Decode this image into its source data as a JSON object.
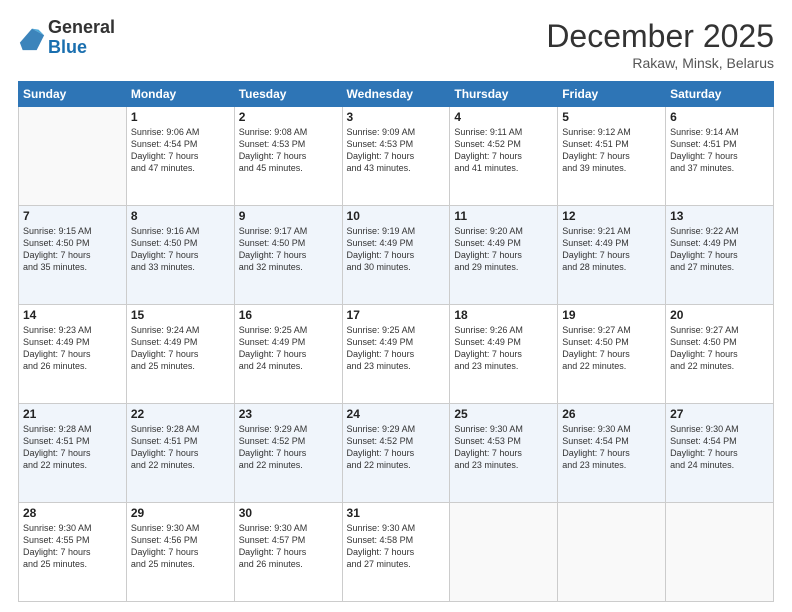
{
  "header": {
    "logo_general": "General",
    "logo_blue": "Blue",
    "title": "December 2025",
    "location": "Rakaw, Minsk, Belarus"
  },
  "days_of_week": [
    "Sunday",
    "Monday",
    "Tuesday",
    "Wednesday",
    "Thursday",
    "Friday",
    "Saturday"
  ],
  "weeks": [
    {
      "days": [
        {
          "num": "",
          "info": ""
        },
        {
          "num": "1",
          "info": "Sunrise: 9:06 AM\nSunset: 4:54 PM\nDaylight: 7 hours\nand 47 minutes."
        },
        {
          "num": "2",
          "info": "Sunrise: 9:08 AM\nSunset: 4:53 PM\nDaylight: 7 hours\nand 45 minutes."
        },
        {
          "num": "3",
          "info": "Sunrise: 9:09 AM\nSunset: 4:53 PM\nDaylight: 7 hours\nand 43 minutes."
        },
        {
          "num": "4",
          "info": "Sunrise: 9:11 AM\nSunset: 4:52 PM\nDaylight: 7 hours\nand 41 minutes."
        },
        {
          "num": "5",
          "info": "Sunrise: 9:12 AM\nSunset: 4:51 PM\nDaylight: 7 hours\nand 39 minutes."
        },
        {
          "num": "6",
          "info": "Sunrise: 9:14 AM\nSunset: 4:51 PM\nDaylight: 7 hours\nand 37 minutes."
        }
      ]
    },
    {
      "days": [
        {
          "num": "7",
          "info": "Sunrise: 9:15 AM\nSunset: 4:50 PM\nDaylight: 7 hours\nand 35 minutes."
        },
        {
          "num": "8",
          "info": "Sunrise: 9:16 AM\nSunset: 4:50 PM\nDaylight: 7 hours\nand 33 minutes."
        },
        {
          "num": "9",
          "info": "Sunrise: 9:17 AM\nSunset: 4:50 PM\nDaylight: 7 hours\nand 32 minutes."
        },
        {
          "num": "10",
          "info": "Sunrise: 9:19 AM\nSunset: 4:49 PM\nDaylight: 7 hours\nand 30 minutes."
        },
        {
          "num": "11",
          "info": "Sunrise: 9:20 AM\nSunset: 4:49 PM\nDaylight: 7 hours\nand 29 minutes."
        },
        {
          "num": "12",
          "info": "Sunrise: 9:21 AM\nSunset: 4:49 PM\nDaylight: 7 hours\nand 28 minutes."
        },
        {
          "num": "13",
          "info": "Sunrise: 9:22 AM\nSunset: 4:49 PM\nDaylight: 7 hours\nand 27 minutes."
        }
      ]
    },
    {
      "days": [
        {
          "num": "14",
          "info": "Sunrise: 9:23 AM\nSunset: 4:49 PM\nDaylight: 7 hours\nand 26 minutes."
        },
        {
          "num": "15",
          "info": "Sunrise: 9:24 AM\nSunset: 4:49 PM\nDaylight: 7 hours\nand 25 minutes."
        },
        {
          "num": "16",
          "info": "Sunrise: 9:25 AM\nSunset: 4:49 PM\nDaylight: 7 hours\nand 24 minutes."
        },
        {
          "num": "17",
          "info": "Sunrise: 9:25 AM\nSunset: 4:49 PM\nDaylight: 7 hours\nand 23 minutes."
        },
        {
          "num": "18",
          "info": "Sunrise: 9:26 AM\nSunset: 4:49 PM\nDaylight: 7 hours\nand 23 minutes."
        },
        {
          "num": "19",
          "info": "Sunrise: 9:27 AM\nSunset: 4:50 PM\nDaylight: 7 hours\nand 22 minutes."
        },
        {
          "num": "20",
          "info": "Sunrise: 9:27 AM\nSunset: 4:50 PM\nDaylight: 7 hours\nand 22 minutes."
        }
      ]
    },
    {
      "days": [
        {
          "num": "21",
          "info": "Sunrise: 9:28 AM\nSunset: 4:51 PM\nDaylight: 7 hours\nand 22 minutes."
        },
        {
          "num": "22",
          "info": "Sunrise: 9:28 AM\nSunset: 4:51 PM\nDaylight: 7 hours\nand 22 minutes."
        },
        {
          "num": "23",
          "info": "Sunrise: 9:29 AM\nSunset: 4:52 PM\nDaylight: 7 hours\nand 22 minutes."
        },
        {
          "num": "24",
          "info": "Sunrise: 9:29 AM\nSunset: 4:52 PM\nDaylight: 7 hours\nand 22 minutes."
        },
        {
          "num": "25",
          "info": "Sunrise: 9:30 AM\nSunset: 4:53 PM\nDaylight: 7 hours\nand 23 minutes."
        },
        {
          "num": "26",
          "info": "Sunrise: 9:30 AM\nSunset: 4:54 PM\nDaylight: 7 hours\nand 23 minutes."
        },
        {
          "num": "27",
          "info": "Sunrise: 9:30 AM\nSunset: 4:54 PM\nDaylight: 7 hours\nand 24 minutes."
        }
      ]
    },
    {
      "days": [
        {
          "num": "28",
          "info": "Sunrise: 9:30 AM\nSunset: 4:55 PM\nDaylight: 7 hours\nand 25 minutes."
        },
        {
          "num": "29",
          "info": "Sunrise: 9:30 AM\nSunset: 4:56 PM\nDaylight: 7 hours\nand 25 minutes."
        },
        {
          "num": "30",
          "info": "Sunrise: 9:30 AM\nSunset: 4:57 PM\nDaylight: 7 hours\nand 26 minutes."
        },
        {
          "num": "31",
          "info": "Sunrise: 9:30 AM\nSunset: 4:58 PM\nDaylight: 7 hours\nand 27 minutes."
        },
        {
          "num": "",
          "info": ""
        },
        {
          "num": "",
          "info": ""
        },
        {
          "num": "",
          "info": ""
        }
      ]
    }
  ]
}
